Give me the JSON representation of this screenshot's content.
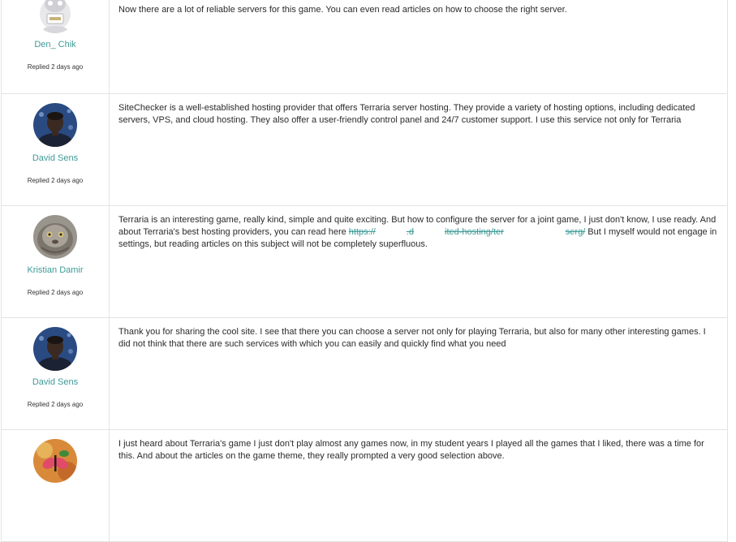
{
  "posts": [
    {
      "author": "Den_ Chik",
      "avatar_icon": "robot-avatar-icon",
      "replied": "Replied 2 days ago",
      "text": "Now there are a lot of reliable servers for this game. You can even read articles on how to choose the right server."
    },
    {
      "author": "David Sens",
      "avatar_icon": "person-avatar-icon",
      "replied": "Replied 2 days ago",
      "text": "SiteChecker is a well-established hosting provider that offers Terraria server hosting. They provide a variety of hosting options, including dedicated servers, VPS, and cloud hosting. They also offer a user-friendly control panel and 24/7 customer support. I use this service not only for Terraria"
    },
    {
      "author": "Kristian Damir",
      "avatar_icon": "cat-avatar-icon",
      "replied": "Replied 2 days ago",
      "text_before": "Terraria is an interesting game, really kind, simple and quite exciting. But how to configure the server for a joint game, I just don't know, I use ready. And about Terraria's best hosting providers, you can read here ",
      "link_start": "https://",
      "link_mid1": ".d",
      "link_mid2": "ited-hosting/ter",
      "link_mid3": "ser",
      "link_end": "g/",
      "text_after": " But I myself would not engage in settings, but reading articles on this subject will not be completely superfluous."
    },
    {
      "author": "David Sens",
      "avatar_icon": "person-avatar-icon",
      "replied": "Replied 2 days ago",
      "text": "Thank you for sharing the cool site. I see that there you can choose a server not only for playing Terraria, but also for many other interesting games. I did not think that there are such services with which you can easily and quickly find what you need"
    },
    {
      "author": "",
      "avatar_icon": "butterfly-avatar-icon",
      "replied": "",
      "text": "I just heard about Terraria's game I just don't play almost any games now, in my student years I played all the games that I liked, there was a time for this. And about the articles on the game theme, they really prompted a very good selection above."
    }
  ],
  "colors": {
    "author_link": "#3d9a96",
    "border": "#e3e3e3",
    "text": "#2b2b2b"
  }
}
